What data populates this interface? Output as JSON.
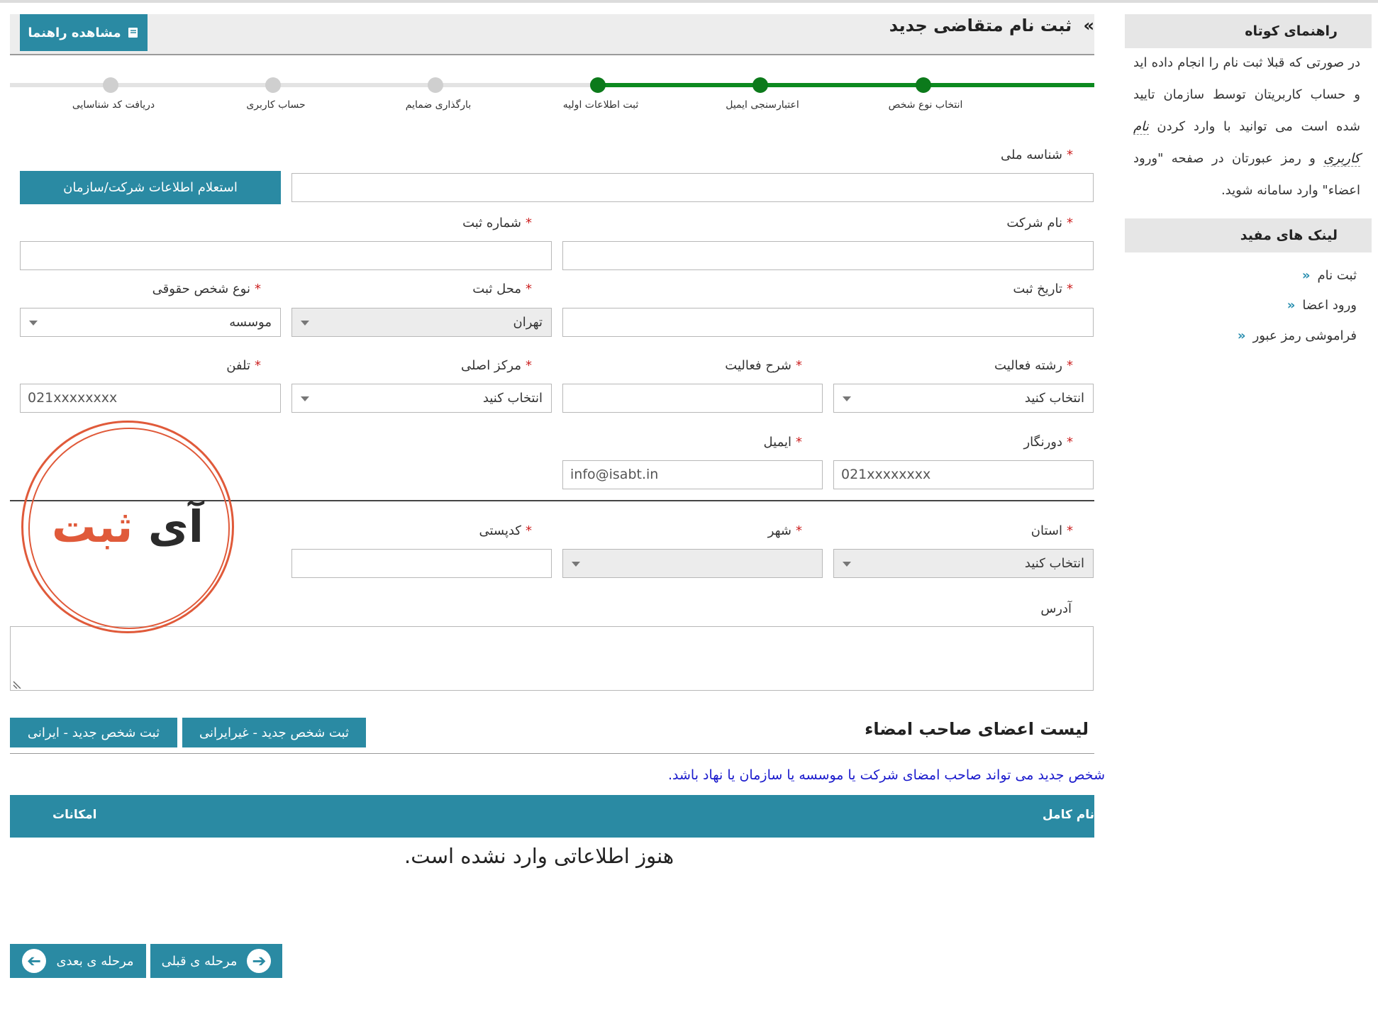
{
  "sidebar": {
    "guide_title": "راهنمای کوتاه",
    "guide_text_1": "در صورتی که قبلا ثبت نام را انجام داده اید و حساب کاربریتان توسط سازمان تایید شده است می توانید با وارد کردن",
    "guide_text_accent": "نام کاربری",
    "guide_text_2": "و رمز عبورتان در صفحه \"ورود اعضاء\" وارد سامانه شوید.",
    "links_title": "لینک های مفید",
    "links": [
      "ثبت نام",
      "ورود اعضا",
      "فراموشی رمز عبور"
    ]
  },
  "header": {
    "title": "ثبت نام متقاضی جدید",
    "guide_button": "مشاهده راهنما"
  },
  "stepper": {
    "steps": [
      "انتخاب نوع شخص",
      "اعتبارسنجی ایمیل",
      "ثبت اطلاعات اولیه",
      "بارگذاری ضمایم",
      "حساب کاربری",
      "دریافت کد شناسایی"
    ],
    "completed": 3
  },
  "form": {
    "national_id_label": "شناسه ملی",
    "inquiry_button": "استعلام اطلاعات شرکت/سازمان",
    "company_name_label": "نام شرکت",
    "reg_number_label": "شماره ثبت",
    "reg_date_label": "تاریخ ثبت",
    "reg_place_label": "محل ثبت",
    "reg_place_value": "تهران",
    "entity_type_label": "نوع شخص حقوقی",
    "entity_type_value": "موسسه",
    "activity_field_label": "رشته فعالیت",
    "activity_field_value": "انتخاب کنید",
    "activity_desc_label": "شرح فعالیت",
    "main_center_label": "مرکز اصلی",
    "main_center_value": "انتخاب کنید",
    "phone_label": "تلفن",
    "phone_placeholder": "021xxxxxxxx",
    "fax_label": "دورنگار",
    "fax_placeholder": "021xxxxxxxx",
    "email_label": "ایمیل",
    "email_placeholder": "info@isabt.in",
    "province_label": "استان",
    "province_value": "انتخاب کنید",
    "city_label": "شهر",
    "postal_label": "کدپستی",
    "address_label": "آدرس",
    "required_mark": "*"
  },
  "stamp": {
    "word1": "آی",
    "word2": "ثبت"
  },
  "signers": {
    "title": "لیست اعضای صاحب امضاء",
    "add_foreign": "ثبت شخص جدید - غیرایرانی",
    "add_iranian": "ثبت شخص جدید - ایرانی",
    "note": "شخص جدید می تواند صاحب امضای شرکت یا موسسه یا سازمان یا نهاد باشد.",
    "columns": [
      "نام کامل",
      "امکانات"
    ],
    "empty_message": "هنوز اطلاعاتی وارد نشده است."
  },
  "nav": {
    "prev": "مرحله ی قبلی",
    "next": "مرحله ی بعدی"
  },
  "colors": {
    "accent": "#2a8aa3",
    "step_done": "#0c7a1b",
    "required": "#cc2222",
    "stamp": "#e05a3a"
  }
}
